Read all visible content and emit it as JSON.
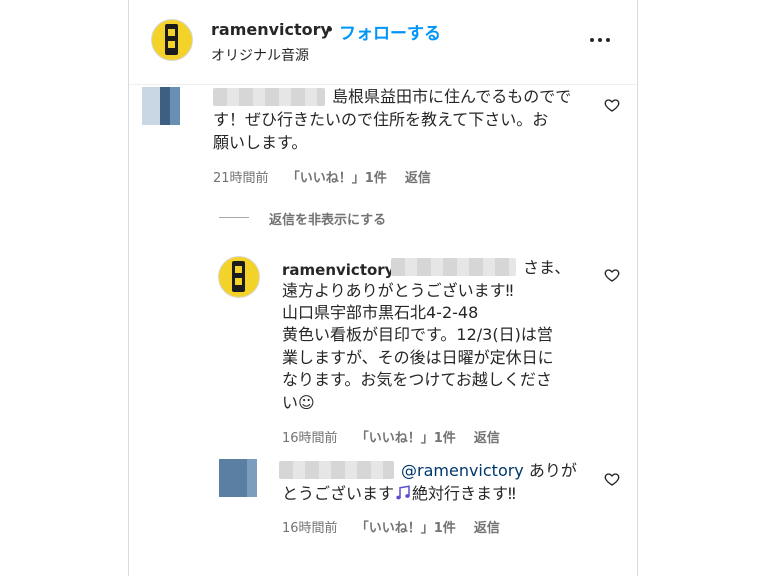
{
  "post": {
    "username": "ramenvictory",
    "separator": "•",
    "follow_label": "フォローする",
    "audio_label": "オリジナル音源"
  },
  "comments": [
    {
      "text_lines": [
        "島根県益田市に住んでるものでで",
        "す！ぜひ行きたいので住所を教えて下さい。お",
        "願いします。"
      ],
      "time": "21時間前",
      "likes": "「いいね！」1件",
      "reply_label": "返信"
    }
  ],
  "hide_replies_label": "返信を非表示にする",
  "replies": [
    {
      "username": "ramenvictory",
      "text_lines": [
        "さま、",
        "遠方よりありがとうございます‼",
        "山口県宇部市黒石北4-2-48",
        "黄色い看板が目印です。12/3(日)は営",
        "業しますが、その後は日曜が定休日に",
        "なります。お気をつけてお越しくださ",
        "い☺"
      ],
      "time": "16時間前",
      "likes": "「いいね！」1件",
      "reply_label": "返信"
    },
    {
      "mention": "@ramenvictory",
      "text_lines": [
        "ありが",
        "とうございます",
        "絶対行きます‼"
      ],
      "time": "16時間前",
      "likes": "「いいね！」1件",
      "reply_label": "返信"
    }
  ],
  "icons": {
    "more": "more-options-icon",
    "heart": "heart-icon",
    "music": "music-notes-icon"
  },
  "colors": {
    "link_blue": "#0095f6",
    "mention": "#00376b",
    "meta_gray": "#737373",
    "logo_yellow": "#f3d22a"
  }
}
